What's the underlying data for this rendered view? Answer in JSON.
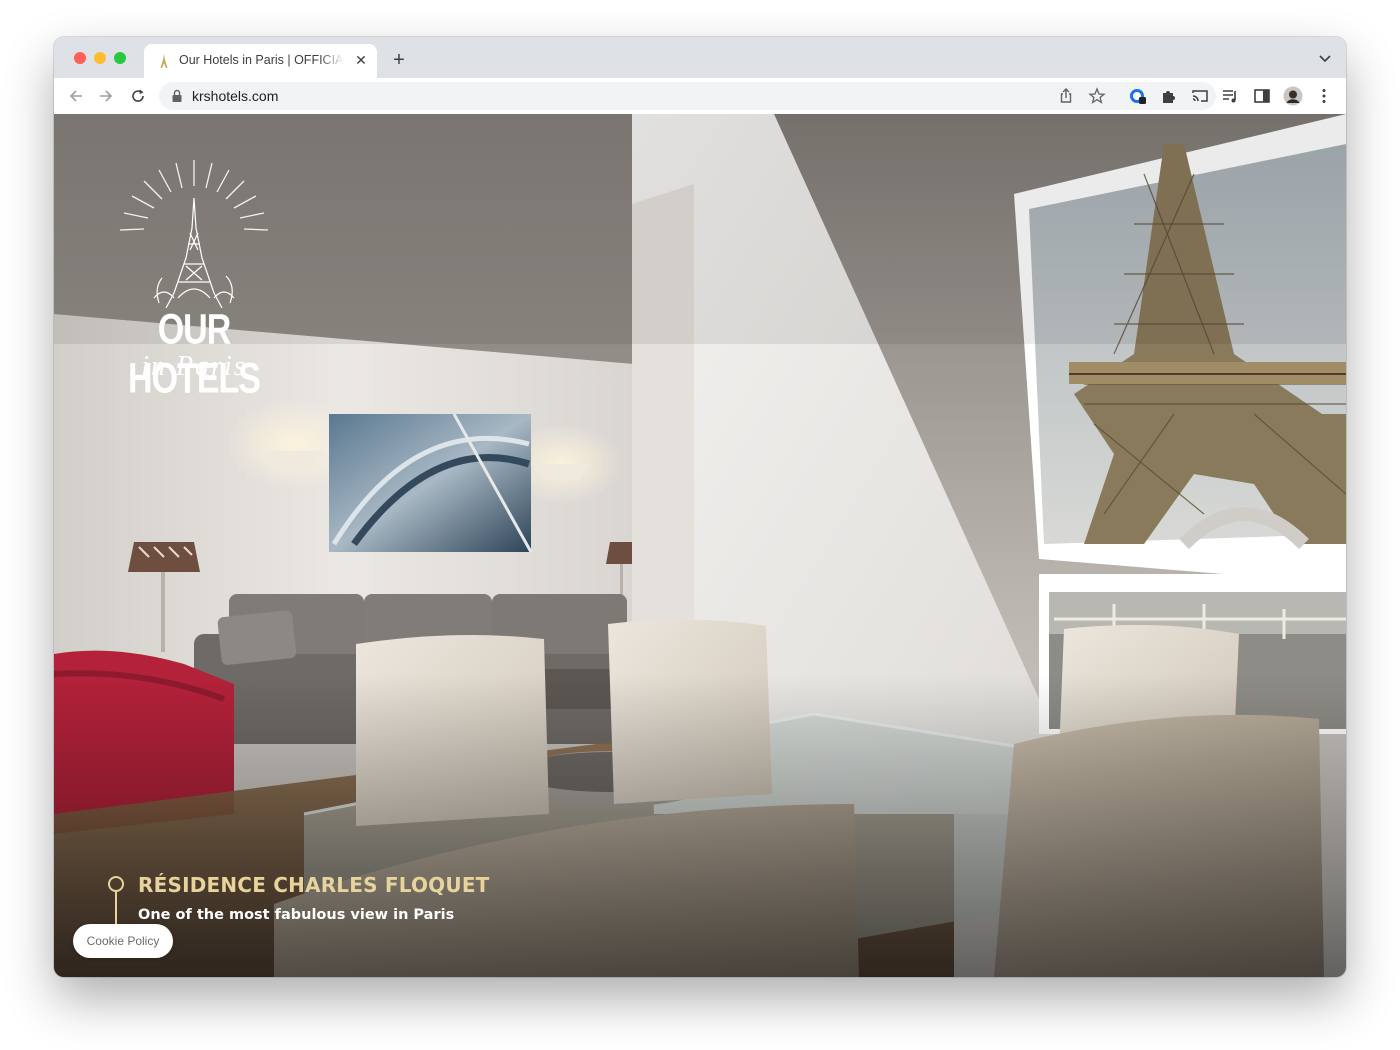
{
  "browser": {
    "tab": {
      "title": "Our Hotels in Paris | OFFICIAL SITE",
      "close_glyph": "✕",
      "favicon": "eiffel-favicon-icon"
    },
    "new_tab_glyph": "+",
    "address_bar": {
      "url": "krshotels.com",
      "secure_icon": "lock-icon"
    },
    "nav_icons": [
      "back-icon",
      "forward-icon",
      "reload-icon"
    ],
    "omnibox_icons": [
      "share-icon",
      "bookmark-star-icon"
    ],
    "extension_icons": [
      "extension-badge-icon",
      "puzzle-icon",
      "cast-icon",
      "reading-list-icon",
      "side-panel-icon",
      "profile-avatar",
      "menu-kebab-icon"
    ]
  },
  "page": {
    "logo": {
      "title": "OUR HOTELS",
      "subtitle": "in Paris"
    },
    "hero": {
      "title": "RÉSIDENCE CHARLES FLOQUET",
      "subtitle": "One of the most fabulous view in Paris"
    },
    "cookie_button": "Cookie Policy"
  },
  "colors": {
    "accent_gold": "#e6d49c",
    "sofa_red": "#b4223a",
    "wall": "#e9e6e2"
  }
}
